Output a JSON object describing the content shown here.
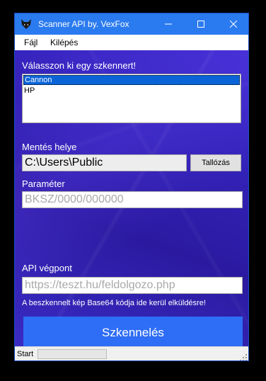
{
  "window": {
    "title": "Scanner API by. VexFox",
    "minimize_icon": "minimize-icon",
    "maximize_icon": "maximize-icon",
    "close_icon": "close-icon",
    "titlebar_color": "#2b7bf0"
  },
  "menu": {
    "items": [
      "Fájl",
      "Kilépés"
    ]
  },
  "scanner": {
    "label": "Válasszon ki egy szkennert!",
    "items": [
      "Cannon",
      "HP"
    ],
    "selected": "Cannon"
  },
  "save": {
    "label": "Mentés helye",
    "value": "C:\\Users\\Public",
    "browse_label": "Tallózás"
  },
  "param": {
    "label": "Paraméter",
    "placeholder": "BKSZ/0000/000000"
  },
  "api": {
    "label": "API végpont",
    "placeholder": "https://teszt.hu/feldolgozo.php",
    "hint": "A beszkennelt kép Base64 kódja ide kerül elküldésre!"
  },
  "scan_button": {
    "label": "Szkennelés",
    "color": "#2e6df6"
  },
  "status": {
    "text": "Start",
    "progress": 0
  }
}
